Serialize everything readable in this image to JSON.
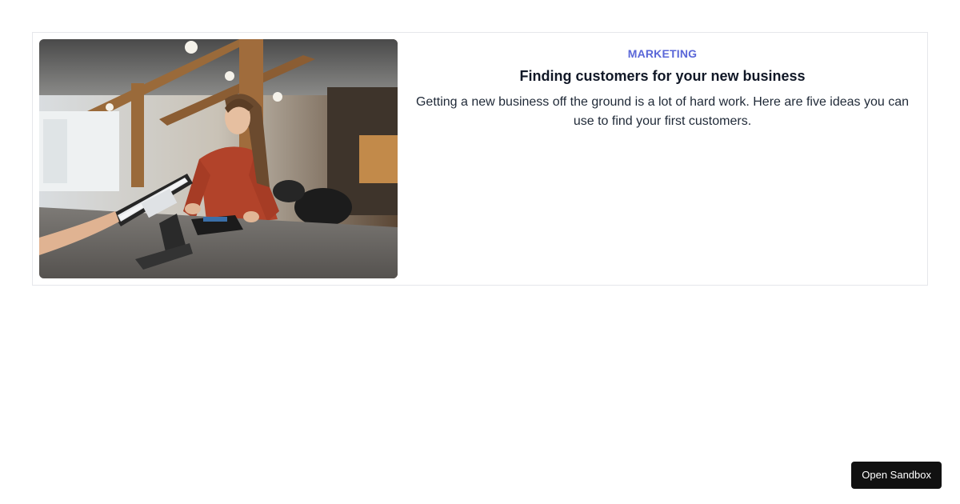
{
  "card": {
    "image_alt": "Woman at a cafe counter using a point-of-sale tablet",
    "category": "Marketing",
    "title": "Finding customers for your new business",
    "description": "Getting a new business off the ground is a lot of hard work. Here are five ideas you can use to find your first customers."
  },
  "sandbox": {
    "label": "Open Sandbox"
  },
  "colors": {
    "accent": "#5a67d8",
    "button_bg": "#111111",
    "border": "#e5e7eb"
  }
}
